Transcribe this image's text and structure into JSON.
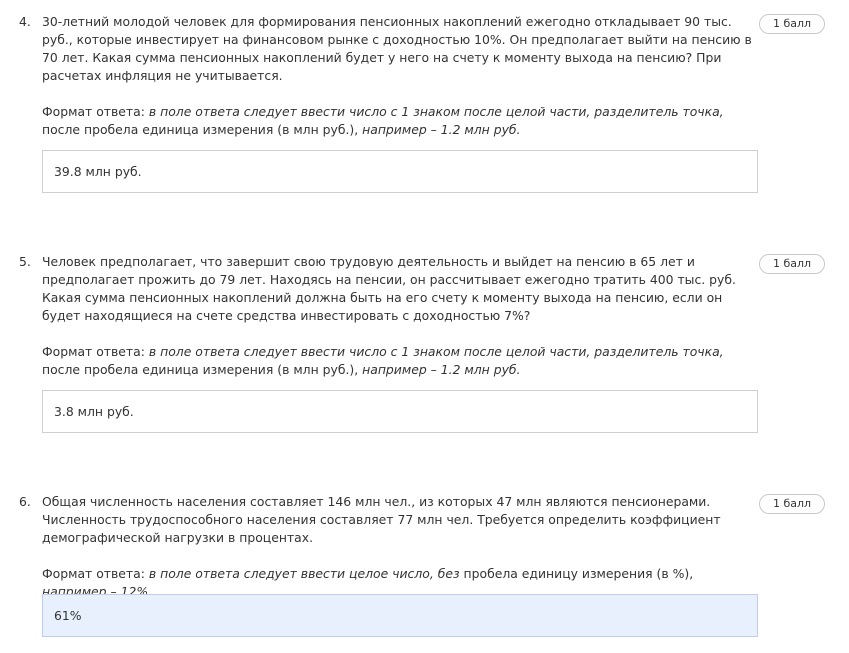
{
  "questions": [
    {
      "number": "4.",
      "text": "30-летний молодой человек для формирования пенсионных накоплений ежегодно откладывает 90 тыс. руб., которые инвестирует на финансовом рынке с доходностью 10%. Он предполагает выйти на пенсию в 70 лет. Какая сумма пенсионных накоплений будет у него на счету к моменту выхода на пенсию? При расчетах инфляция не учитывается.",
      "format_label": "Формат ответа:",
      "format_em1": "в поле ответа следует ввести число с 1 знаком после целой части, разделитель точка,",
      "format_plain": "после пробела единица измерения (в млн руб.),",
      "format_em2": "например – 1.2 млн руб.",
      "points": "1 балл",
      "answer": "39.8 млн руб."
    },
    {
      "number": "5.",
      "text": "Человек предполагает, что завершит свою трудовую деятельность и выйдет на пенсию в 65 лет и предполагает прожить до 79 лет. Находясь на пенсии, он рассчитывает ежегодно тратить 400 тыс. руб. Какая сумма пенсионных накоплений должна быть на его счету к моменту выхода на пенсию, если он будет находящиеся на счете средства инвестировать с доходностью 7%?",
      "format_label": "Формат ответа:",
      "format_em1": "в поле ответа следует ввести число с 1 знаком после целой части, разделитель точка,",
      "format_plain": "после пробела единица измерения (в млн руб.),",
      "format_em2": "например – 1.2 млн руб.",
      "points": "1 балл",
      "answer": "3.8 млн руб."
    },
    {
      "number": "6.",
      "text": "Общая численность населения составляет 146 млн чел., из которых 47 млн являются пенсионерами. Численность трудоспособного населения составляет 77 млн чел. Требуется определить коэффициент демографической нагрузки в процентах.",
      "format_label": "Формат ответа:",
      "format_em1": "в поле ответа следует ввести целое число, без",
      "format_plain": "пробела единицу измерения (в %),",
      "format_em2": "например – 12%",
      "points": "1 балл",
      "answer": "61%"
    }
  ]
}
